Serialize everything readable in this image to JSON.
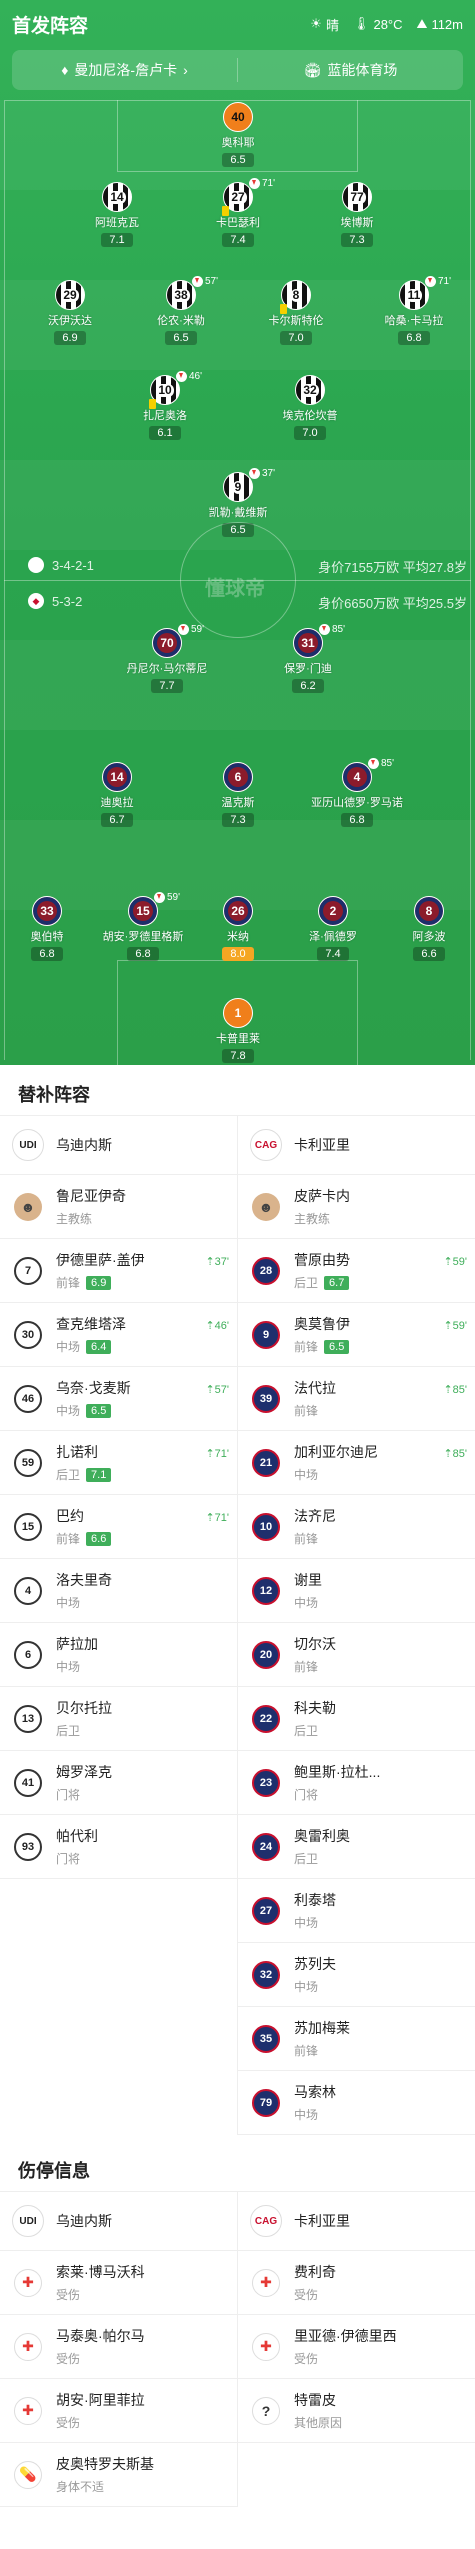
{
  "header": {
    "title": "首发阵容",
    "weather": "晴",
    "temp": "28°C",
    "altitude": "112m"
  },
  "infobar": {
    "coach_match": "曼加尼洛-詹卢卡",
    "stadium": "蓝能体育场"
  },
  "pitch": {
    "watermark": "懂球帝",
    "home": {
      "formation": "3-4-2-1",
      "value": "身价7155万欧  平均27.8岁"
    },
    "away": {
      "formation": "5-3-2",
      "value": "身价6650万欧  平均25.5岁"
    }
  },
  "players": [
    {
      "num": "40",
      "name": "奥科耶",
      "rating": "6.5",
      "team": "gk1"
    },
    {
      "num": "14",
      "name": "阿班克瓦",
      "rating": "7.1",
      "team": "home"
    },
    {
      "num": "27",
      "name": "卡巴瑟利",
      "rating": "7.4",
      "team": "home",
      "time": "71'"
    },
    {
      "num": "77",
      "name": "埃博斯",
      "rating": "7.3",
      "team": "home"
    },
    {
      "num": "29",
      "name": "沃伊沃达",
      "rating": "6.9",
      "team": "home"
    },
    {
      "num": "38",
      "name": "伦农·米勒",
      "rating": "6.5",
      "team": "home",
      "time": "57'"
    },
    {
      "num": "8",
      "name": "卡尔斯特伦",
      "rating": "7.0",
      "team": "home"
    },
    {
      "num": "11",
      "name": "哈桑·卡马拉",
      "rating": "6.8",
      "team": "home",
      "time": "71'"
    },
    {
      "num": "10",
      "name": "扎尼奥洛",
      "rating": "6.1",
      "team": "home",
      "time": "46'"
    },
    {
      "num": "32",
      "name": "埃克伦坎普",
      "rating": "7.0",
      "team": "home"
    },
    {
      "num": "9",
      "name": "凯勒·戴维斯",
      "rating": "6.5",
      "team": "home",
      "time": "37'"
    },
    {
      "num": "70",
      "name": "丹尼尔·马尔蒂尼",
      "rating": "7.7",
      "team": "away",
      "time": "59'"
    },
    {
      "num": "31",
      "name": "保罗·门迪",
      "rating": "6.2",
      "team": "away",
      "time": "85'"
    },
    {
      "num": "14",
      "name": "迪奥拉",
      "rating": "6.7",
      "team": "away"
    },
    {
      "num": "6",
      "name": "温克斯",
      "rating": "7.3",
      "team": "away"
    },
    {
      "num": "4",
      "name": "亚历山德罗·罗马诺",
      "rating": "6.8",
      "team": "away",
      "time": "85'"
    },
    {
      "num": "33",
      "name": "奥伯特",
      "rating": "6.8",
      "team": "away"
    },
    {
      "num": "15",
      "name": "胡安·罗德里格斯",
      "rating": "6.8",
      "team": "away",
      "time": "59'"
    },
    {
      "num": "26",
      "name": "米纳",
      "rating": "8.0",
      "team": "away"
    },
    {
      "num": "2",
      "name": "泽·佩德罗",
      "rating": "7.4",
      "team": "away"
    },
    {
      "num": "8",
      "name": "阿多波",
      "rating": "6.6",
      "team": "away"
    },
    {
      "num": "1",
      "name": "卡普里莱",
      "rating": "7.8",
      "team": "gk2"
    }
  ],
  "subs": {
    "title": "替补阵容",
    "home_team": "乌迪内斯",
    "away_team": "卡利亚里",
    "home": [
      {
        "num": "",
        "name": "鲁尼亚伊奇",
        "pos": "主教练",
        "coach": true
      },
      {
        "num": "7",
        "name": "伊德里萨·盖伊",
        "pos": "前锋",
        "rating": "6.9",
        "time": "37'"
      },
      {
        "num": "30",
        "name": "查克维塔泽",
        "pos": "中场",
        "rating": "6.4",
        "time": "46'"
      },
      {
        "num": "46",
        "name": "乌奈·戈麦斯",
        "pos": "中场",
        "rating": "6.5",
        "time": "57'"
      },
      {
        "num": "59",
        "name": "扎诺利",
        "pos": "后卫",
        "rating": "7.1",
        "time": "71'"
      },
      {
        "num": "15",
        "name": "巴约",
        "pos": "前锋",
        "rating": "6.6",
        "time": "71'"
      },
      {
        "num": "4",
        "name": "洛夫里奇",
        "pos": "中场"
      },
      {
        "num": "6",
        "name": "萨拉加",
        "pos": "中场"
      },
      {
        "num": "13",
        "name": "贝尔托拉",
        "pos": "后卫"
      },
      {
        "num": "41",
        "name": "姆罗泽克",
        "pos": "门将"
      },
      {
        "num": "93",
        "name": "帕代利",
        "pos": "门将"
      }
    ],
    "away": [
      {
        "num": "",
        "name": "皮萨卡内",
        "pos": "主教练",
        "coach": true
      },
      {
        "num": "28",
        "name": "菅原由势",
        "pos": "后卫",
        "rating": "6.7",
        "time": "59'"
      },
      {
        "num": "9",
        "name": "奥莫鲁伊",
        "pos": "前锋",
        "rating": "6.5",
        "time": "59'"
      },
      {
        "num": "39",
        "name": "法代拉",
        "pos": "前锋",
        "time": "85'"
      },
      {
        "num": "21",
        "name": "加利亚尔迪尼",
        "pos": "中场",
        "time": "85'"
      },
      {
        "num": "10",
        "name": "法齐尼",
        "pos": "前锋"
      },
      {
        "num": "12",
        "name": "谢里",
        "pos": "中场"
      },
      {
        "num": "20",
        "name": "切尔沃",
        "pos": "前锋"
      },
      {
        "num": "22",
        "name": "科夫勒",
        "pos": "后卫"
      },
      {
        "num": "23",
        "name": "鲍里斯·拉杜...",
        "pos": "门将"
      },
      {
        "num": "24",
        "name": "奥雷利奥",
        "pos": "后卫"
      },
      {
        "num": "27",
        "name": "利泰塔",
        "pos": "中场"
      },
      {
        "num": "32",
        "name": "苏列夫",
        "pos": "中场"
      },
      {
        "num": "35",
        "name": "苏加梅莱",
        "pos": "前锋"
      },
      {
        "num": "79",
        "name": "马索林",
        "pos": "中场"
      }
    ]
  },
  "injuries": {
    "title": "伤停信息",
    "home_team": "乌迪内斯",
    "away_team": "卡利亚里",
    "home": [
      {
        "name": "索莱·博马沃科",
        "reason": "受伤",
        "icon": "medical-kit-icon"
      },
      {
        "name": "马泰奥·帕尔马",
        "reason": "受伤",
        "icon": "medical-kit-icon"
      },
      {
        "name": "胡安·阿里菲拉",
        "reason": "受伤",
        "icon": "medical-kit-icon"
      },
      {
        "name": "皮奥特罗夫斯基",
        "reason": "身体不适",
        "icon": "pill-icon"
      }
    ],
    "away": [
      {
        "name": "费利奇",
        "reason": "受伤",
        "icon": "medical-kit-icon"
      },
      {
        "name": "里亚德·伊德里西",
        "reason": "受伤",
        "icon": "medical-kit-icon"
      },
      {
        "name": "特雷皮",
        "reason": "其他原因",
        "icon": "question-icon"
      }
    ]
  },
  "colors": {
    "pitch": "#2ea851",
    "rating_green": "#3fae5a",
    "away_red": "#8c1b2b",
    "gk_orange": "#f07f1b"
  }
}
